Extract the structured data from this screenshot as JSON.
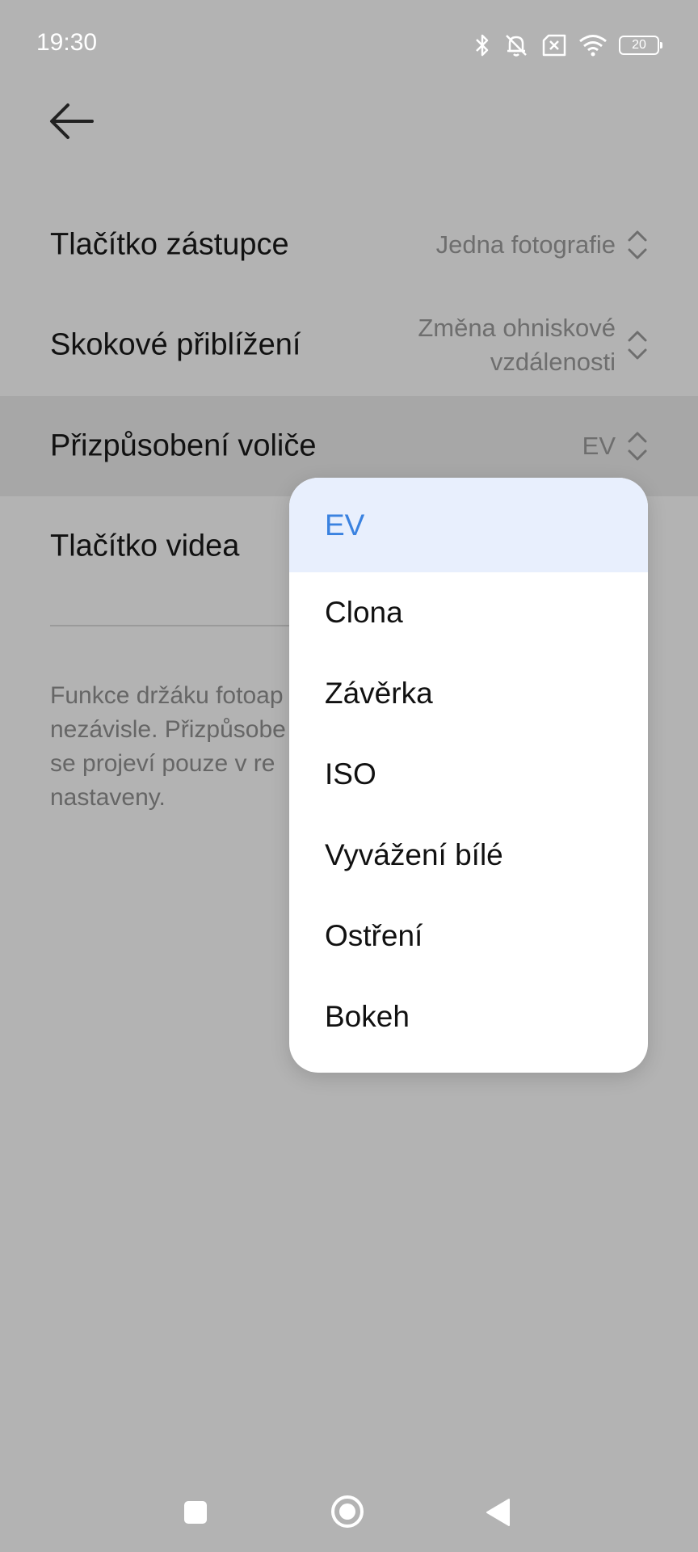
{
  "status_bar": {
    "time": "19:30",
    "battery": "20",
    "icons": [
      "bluetooth-icon",
      "mute-bell-icon",
      "no-sim-icon",
      "wifi-icon",
      "battery-icon"
    ]
  },
  "header": {
    "back_icon": "arrow-left-icon"
  },
  "settings": [
    {
      "label": "Tlačítko zástupce",
      "value": "Jedna fotografie"
    },
    {
      "label": "Skokové přiblížení",
      "value_line1": "Změna ohniskové",
      "value_line2": "vzdálenosti"
    },
    {
      "label": "Přizpůsobení voliče",
      "value": "EV"
    },
    {
      "label": "Tlačítko videa"
    }
  ],
  "footnote": {
    "lines": [
      "Funkce držáku fotoap",
      "nezávisle. Přizpůsobe",
      "se projeví pouze v re",
      "nastaveny."
    ]
  },
  "dropdown": {
    "selected": "EV",
    "options": [
      "EV",
      "Clona",
      "Závěrka",
      "ISO",
      "Vyvážení bílé",
      "Ostření",
      "Bokeh"
    ]
  },
  "colors": {
    "accent": "#3a82e0",
    "overlay_background": "#b3b3b3",
    "selected_background": "#e8effd"
  }
}
